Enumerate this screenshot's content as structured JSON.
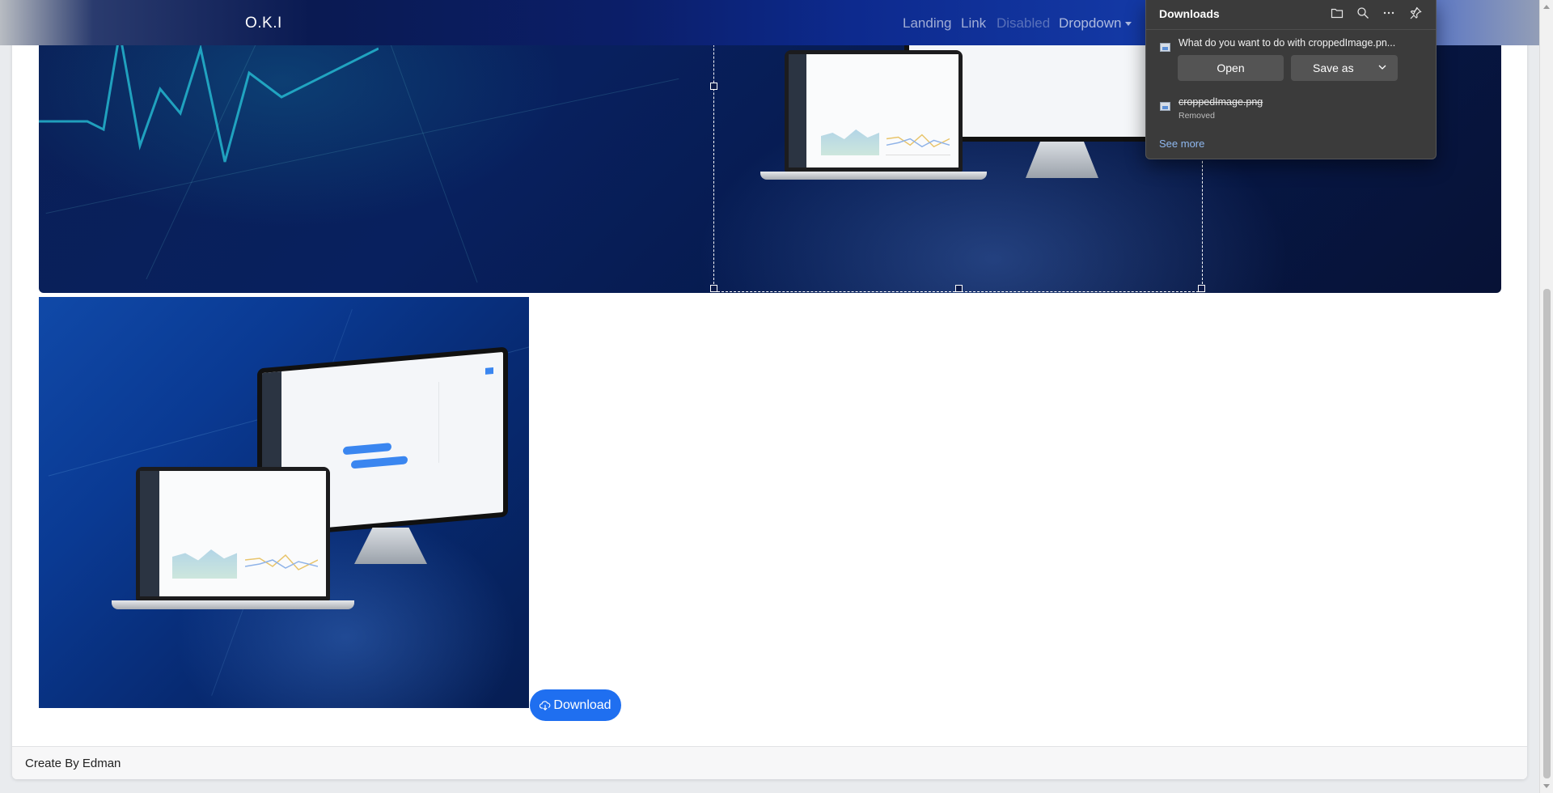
{
  "navbar": {
    "brand": "O.K.I",
    "links": [
      "Landing",
      "Link",
      "Disabled",
      "Dropdown"
    ]
  },
  "main": {
    "download_button": "Download"
  },
  "footer": {
    "text": "Create By Edman"
  },
  "downloads_panel": {
    "title": "Downloads",
    "question": "What do you want to do with croppedImage.pn...",
    "open_label": "Open",
    "save_as_label": "Save as",
    "removed_file": "croppedImage.png",
    "removed_status": "Removed",
    "see_more": "See more"
  },
  "colors": {
    "primary_button": "#1f6ff0",
    "flyout_bg": "#3b3b3b",
    "link": "#8fb8f0"
  }
}
